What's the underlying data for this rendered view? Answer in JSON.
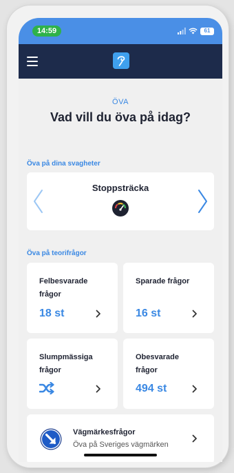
{
  "status": {
    "time": "14:59",
    "battery": "61"
  },
  "header": {
    "menu_icon": "hamburger-icon",
    "logo_icon": "app-logo-icon"
  },
  "page": {
    "eyebrow": "ÖVA",
    "heading": "Vad vill du öva på idag?"
  },
  "weaknesses": {
    "section_label": "Öva på dina svagheter",
    "current_topic": "Stoppsträcka",
    "topic_icon": "gauge-icon"
  },
  "theory": {
    "section_label": "Öva på teorifrågor",
    "cards": [
      {
        "title": "Felbesvarade frågor",
        "value": "18 st"
      },
      {
        "title": "Sparade frågor",
        "value": "16 st"
      },
      {
        "title": "Slumpmässiga frågor",
        "value_icon": "shuffle-icon"
      },
      {
        "title": "Obesvarade frågor",
        "value": "494 st"
      }
    ]
  },
  "signs": {
    "title": "Vägmärkesfrågor",
    "subtitle": "Öva på Sveriges vägmärken",
    "icon": "road-sign-icon"
  },
  "colors": {
    "accent": "#3a88e3",
    "navbar": "#1d2b4b",
    "statusbar": "#4a8fe6",
    "time_pill": "#2fb24a"
  }
}
